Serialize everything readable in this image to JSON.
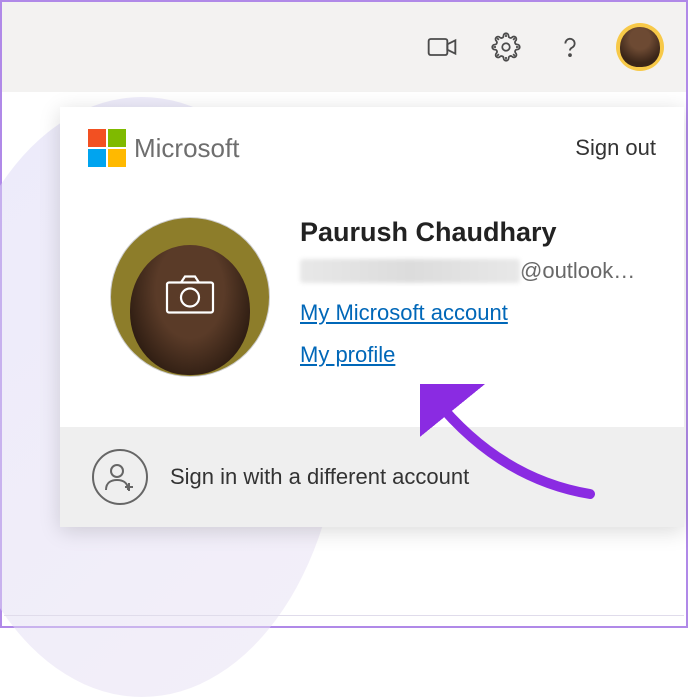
{
  "toolbar": {
    "icons": {
      "video": "video-icon",
      "settings": "gear-icon",
      "help": "help-icon"
    }
  },
  "flyout": {
    "brand": "Microsoft",
    "signout": "Sign out",
    "user": {
      "name": "Paurush Chaudhary",
      "email_suffix": "@outlook…"
    },
    "links": {
      "account": "My Microsoft account",
      "profile": "My profile"
    },
    "footer": {
      "add_account": "Sign in with a different account"
    }
  }
}
